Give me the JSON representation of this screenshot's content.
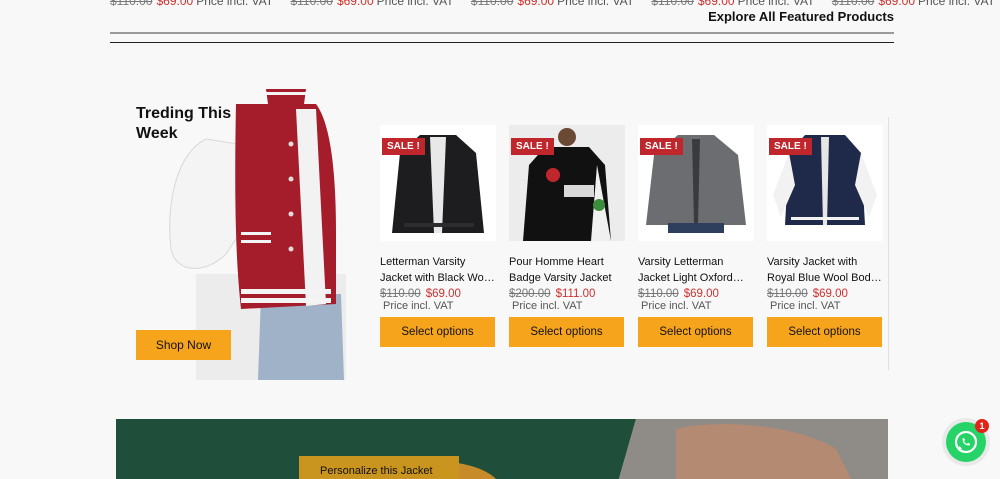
{
  "price_strip": [
    {
      "old": "$110.00",
      "new": "$69.00",
      "vat": "Price incl. VAT"
    },
    {
      "old": "$110.00",
      "new": "$69.00",
      "vat": "Price incl. VAT"
    },
    {
      "old": "$110.00",
      "new": "$69.00",
      "vat": "Price incl. VAT"
    },
    {
      "old": "$110.00",
      "new": "$69.00",
      "vat": "Price incl. VAT"
    },
    {
      "old": "$110.00",
      "new": "$69.00",
      "vat": "Price incl. VAT"
    }
  ],
  "explore_link": "Explore All Featured Products",
  "hero": {
    "title": "Treding This Week",
    "shop_button": "Shop Now"
  },
  "products": [
    {
      "badge": "SALE !",
      "name": "Letterman Varsity Jacket with Black Wo…",
      "old_price": "$110.00",
      "price": "$69.00",
      "vat": "Price incl. VAT",
      "button": "Select options"
    },
    {
      "badge": "SALE !",
      "name": "Pour Homme Heart Badge Varsity Jacket",
      "old_price": "$200.00",
      "price": "$111.00",
      "vat": "Price incl. VAT",
      "button": "Select options"
    },
    {
      "badge": "SALE !",
      "name": "Varsity Letterman Jacket Light Oxford…",
      "old_price": "$110.00",
      "price": "$69.00",
      "vat": "Price incl. VAT",
      "button": "Select options"
    },
    {
      "badge": "SALE !",
      "name": "Varsity Jacket with Royal Blue Wool Bod…",
      "old_price": "$110.00",
      "price": "$69.00",
      "vat": "Price incl. VAT",
      "button": "Select options"
    }
  ],
  "banner": {
    "button": "Personalize this Jacket"
  },
  "whatsapp": {
    "badge_count": "1",
    "icon": "whatsapp-icon"
  },
  "colors": {
    "accent": "#f7a41d",
    "sale": "#c0272d",
    "price_red": "#d0312d",
    "whatsapp": "#25d366"
  }
}
